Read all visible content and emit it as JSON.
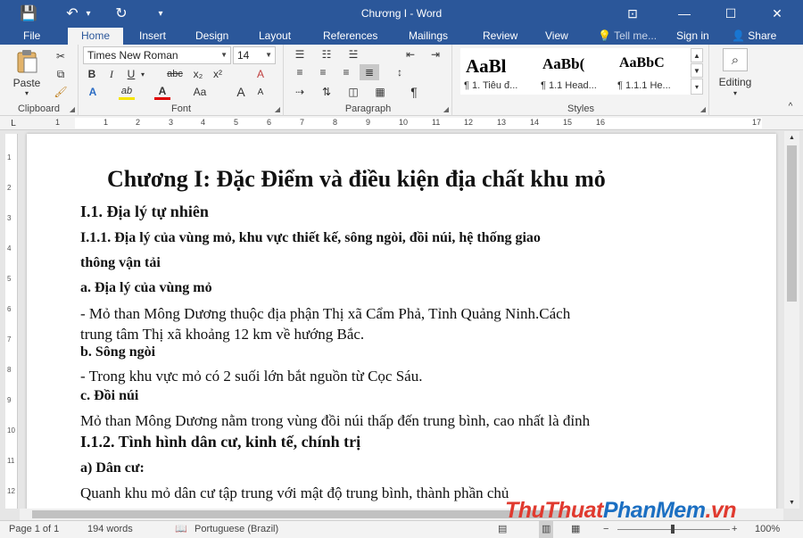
{
  "app": {
    "title": "Chương I - Word",
    "window_controls": {
      "ribbon_options": "⊡",
      "minimize": "—",
      "maximize": "☐",
      "close": "✕"
    },
    "quick_access": {
      "save": "💾",
      "undo": "↶",
      "undo_arrow": "▾",
      "redo": "↻",
      "customize": "▾"
    }
  },
  "tabs": [
    {
      "label": "File"
    },
    {
      "label": "Home"
    },
    {
      "label": "Insert"
    },
    {
      "label": "Design"
    },
    {
      "label": "Layout"
    },
    {
      "label": "References"
    },
    {
      "label": "Mailings"
    },
    {
      "label": "Review"
    },
    {
      "label": "View"
    }
  ],
  "tell_me": {
    "placeholder": "Tell me...",
    "icon": "lightbulb-icon"
  },
  "account": {
    "sign_in": "Sign in",
    "share": "Share"
  },
  "ribbon": {
    "clipboard": {
      "label": "Clipboard",
      "paste": "Paste"
    },
    "font": {
      "label": "Font",
      "font_name": "Times New Roman",
      "font_size": "14",
      "grow": "A",
      "shrink": "A",
      "case": "Aa",
      "clear": "A",
      "bold": "B",
      "italic": "I",
      "underline": "U",
      "strike": "abc",
      "subscript": "x₂",
      "superscript": "x²",
      "effects": "A",
      "highlight": "ab",
      "color": "A",
      "size_case": "Aa"
    },
    "paragraph": {
      "label": "Paragraph",
      "pilcrow": "¶"
    },
    "styles": {
      "label": "Styles",
      "items": [
        {
          "preview": "AaBl",
          "name": "¶ 1. Tiêu đ..."
        },
        {
          "preview": "AaBb(",
          "name": "¶ 1.1 Head..."
        },
        {
          "preview": "AaBbC",
          "name": "¶ 1.1.1 He..."
        }
      ]
    },
    "editing": {
      "label": "Editing"
    }
  },
  "ruler": {
    "numbers": [
      "1",
      "1",
      "2",
      "3",
      "4",
      "5",
      "6",
      "7",
      "8",
      "9",
      "10",
      "11",
      "12",
      "13",
      "14",
      "15",
      "16",
      "17"
    ]
  },
  "vruler": {
    "numbers": [
      "1",
      "2",
      "3",
      "4",
      "5",
      "6",
      "7",
      "8",
      "9",
      "10",
      "11",
      "12"
    ]
  },
  "document": {
    "title": "Chương I: Đặc Điểm và điều kiện địa chất khu mỏ",
    "h_1_1": "I.1. Địa lý tự  nhiên",
    "h_1_1_1_line1": "I.1.1. Địa lý của vùng mỏ, khu vực thiết kế, sông ngòi, đồi núi, hệ thống giao",
    "h_1_1_1_line2": "thông vận tải",
    "h_a": "a. Địa lý của vùng mỏ",
    "p_a_line1": "- Mỏ than Mông Dương thuộc địa phận Thị xã Cẩm Phả, Tỉnh Quảng Ninh.Cách",
    "p_a_line2": "trung tâm Thị xã khoảng 12 km về hướng Bắc.",
    "h_b": "b. Sông ngòi",
    "p_b": "- Trong khu vực mỏ có 2 suối lớn bắt nguồn từ Cọc Sáu.",
    "h_c": "c. Đồi núi",
    "p_c": " Mỏ than Mông Dương nằm trong vùng đồi núi thấp đến trung bình, cao nhất là đỉnh",
    "h_1_1_2": "I.1.2.  Tình hình dân cư, kinh tế, chính trị",
    "h_dan_cu": "a) Dân cư:",
    "p_dan_cu": "Quanh khu mỏ dân cư tập trung với mật độ trung bình, thành phần chủ"
  },
  "status": {
    "page": "Page 1 of 1",
    "words": "194 words",
    "language": "Portuguese (Brazil)",
    "zoom": "100%",
    "zoom_minus": "−",
    "zoom_plus": "+"
  },
  "watermark": {
    "part1": "ThuThuat",
    "part2": "PhanMem",
    "part3": ".vn"
  },
  "colors": {
    "brand": "#2b579a",
    "watermark_red": "#e03a2f",
    "watermark_blue": "#1b6fc2"
  }
}
